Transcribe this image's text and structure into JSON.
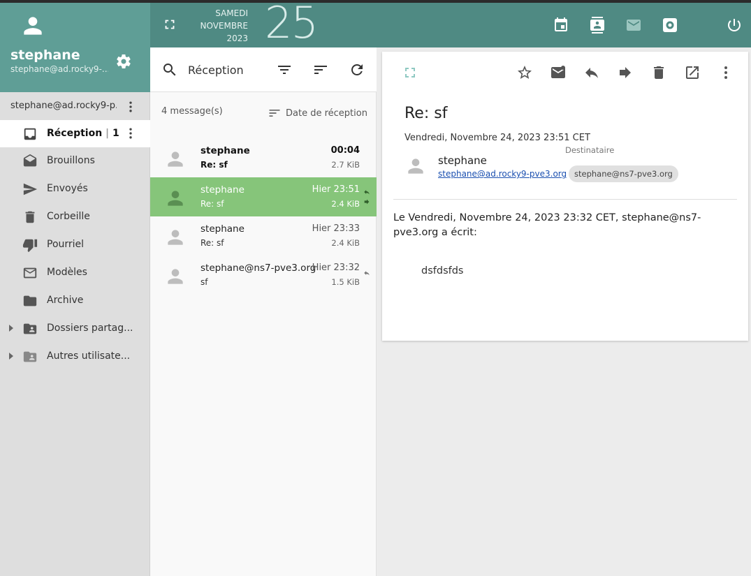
{
  "user": {
    "name": "stephane",
    "email": "stephane@ad.rocky9-..."
  },
  "account": {
    "label": "stephane@ad.rocky9-p..."
  },
  "folders": [
    {
      "label": "Réception",
      "count": "1",
      "icon": "inbox-icon"
    },
    {
      "label": "Brouillons",
      "icon": "drafts-icon"
    },
    {
      "label": "Envoyés",
      "icon": "send-icon"
    },
    {
      "label": "Corbeille",
      "icon": "trash-icon"
    },
    {
      "label": "Pourriel",
      "icon": "thumb-down-icon"
    },
    {
      "label": "Modèles",
      "icon": "mail-outline-icon"
    },
    {
      "label": "Archive",
      "icon": "folder-icon"
    },
    {
      "label": "Dossiers partag...",
      "icon": "shared-folder-icon"
    },
    {
      "label": "Autres utilisate...",
      "icon": "shared-folder-icon"
    }
  ],
  "topbar": {
    "day_name": "SAMEDI",
    "month": "NOVEMBRE",
    "year": "2023",
    "day_number": "25",
    "icons": [
      "calendar-icon",
      "contacts-icon",
      "mail-icon",
      "settings-icon",
      "power-icon"
    ]
  },
  "message_list": {
    "title": "Réception",
    "count_label": "4 message(s)",
    "sort_label": "Date de réception",
    "messages": [
      {
        "from": "stephane",
        "subject": "Re: sf",
        "time": "00:04",
        "size": "2.7 KiB",
        "unread": true,
        "selected": false
      },
      {
        "from": "stephane",
        "subject": "Re: sf",
        "time": "Hier 23:51",
        "size": "2.4 KiB",
        "unread": false,
        "selected": true
      },
      {
        "from": "stephane",
        "subject": "Re: sf",
        "time": "Hier 23:33",
        "size": "2.4 KiB",
        "unread": false,
        "selected": false
      },
      {
        "from": "stephane@ns7-pve3.org",
        "subject": "sf",
        "time": "Hier 23:32",
        "size": "1.5 KiB",
        "unread": false,
        "selected": false
      }
    ]
  },
  "reader": {
    "subject": "Re: sf",
    "date": "Vendredi, Novembre 24, 2023 23:51 CET",
    "from_name": "stephane",
    "from_email": "stephane@ad.rocky9-pve3.org",
    "recipient_label": "Destinataire",
    "recipient": "stephane@ns7-pve3.org",
    "body_line": "Le Vendredi, Novembre 24, 2023 23:32 CET, stephane@ns7-pve3.org a écrit:",
    "quote": "dsfdsfds"
  },
  "colors": {
    "sidebar_header": "#5f9e96",
    "topbar": "#4f8a83",
    "selected_message": "#86c57a"
  }
}
